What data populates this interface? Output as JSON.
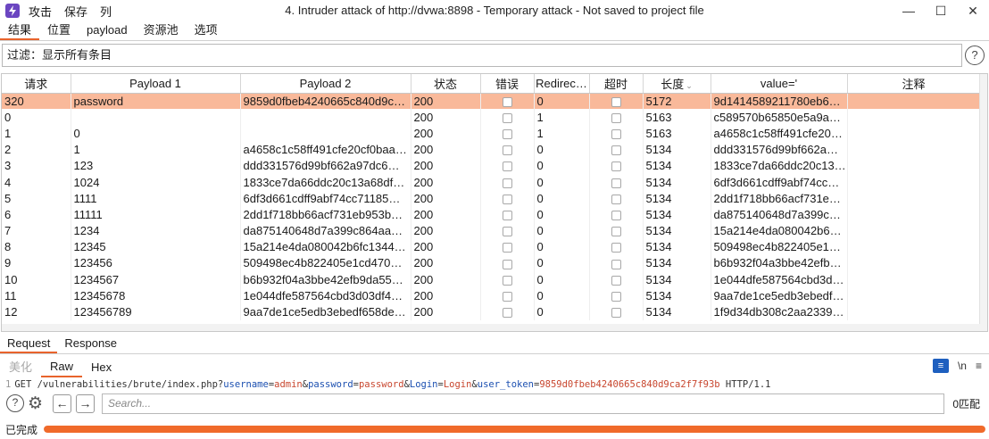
{
  "window": {
    "title": "4. Intruder attack of http://dvwa:8898 - Temporary attack - Not saved to project file",
    "menu": [
      "攻击",
      "保存",
      "列"
    ],
    "controls": [
      "—",
      "☐",
      "✕"
    ]
  },
  "tabs": [
    "结果",
    "位置",
    "payload",
    "资源池",
    "选项"
  ],
  "active_tab": 0,
  "filter": {
    "text": "过滤：显示所有条目"
  },
  "table": {
    "columns": [
      "请求",
      "Payload 1",
      "Payload 2",
      "状态",
      "错误",
      "Redirec…",
      "超时",
      "长度",
      "value='",
      "注释"
    ],
    "rows": [
      [
        "320",
        "password",
        "9859d0fbeb4240665c840d9c…",
        "200",
        "",
        "0",
        "",
        "5172",
        "9d1414589211780eb6…",
        ""
      ],
      [
        "0",
        "",
        "",
        "200",
        "",
        "1",
        "",
        "5163",
        "c589570b65850e5a9a…",
        ""
      ],
      [
        "1",
        "0",
        "",
        "200",
        "",
        "1",
        "",
        "5163",
        "a4658c1c58ff491cfe20…",
        ""
      ],
      [
        "2",
        "1",
        "a4658c1c58ff491cfe20cf0baa…",
        "200",
        "",
        "0",
        "",
        "5134",
        "ddd331576d99bf662a…",
        ""
      ],
      [
        "3",
        "123",
        "ddd331576d99bf662a97dc6…",
        "200",
        "",
        "0",
        "",
        "5134",
        "1833ce7da66ddc20c13…",
        ""
      ],
      [
        "4",
        "1024",
        "1833ce7da66ddc20c13a68df…",
        "200",
        "",
        "0",
        "",
        "5134",
        "6df3d661cdff9abf74cc…",
        ""
      ],
      [
        "5",
        "1111",
        "6df3d661cdff9abf74cc71185…",
        "200",
        "",
        "0",
        "",
        "5134",
        "2dd1f718bb66acf731e…",
        ""
      ],
      [
        "6",
        "11111",
        "2dd1f718bb66acf731eb953b…",
        "200",
        "",
        "0",
        "",
        "5134",
        "da875140648d7a399c…",
        ""
      ],
      [
        "7",
        "1234",
        "da875140648d7a399c864aa…",
        "200",
        "",
        "0",
        "",
        "5134",
        "15a214e4da080042b6…",
        ""
      ],
      [
        "8",
        "12345",
        "15a214e4da080042b6fc1344…",
        "200",
        "",
        "0",
        "",
        "5134",
        "509498ec4b822405e1…",
        ""
      ],
      [
        "9",
        "123456",
        "509498ec4b822405e1cd470…",
        "200",
        "",
        "0",
        "",
        "5134",
        "b6b932f04a3bbe42efb…",
        ""
      ],
      [
        "10",
        "1234567",
        "b6b932f04a3bbe42efb9da55…",
        "200",
        "",
        "0",
        "",
        "5134",
        "1e044dfe587564cbd3d…",
        ""
      ],
      [
        "11",
        "12345678",
        "1e044dfe587564cbd3d03df4…",
        "200",
        "",
        "0",
        "",
        "5134",
        "9aa7de1ce5edb3ebedf…",
        ""
      ],
      [
        "12",
        "123456789",
        "9aa7de1ce5edb3ebedf658de…",
        "200",
        "",
        "0",
        "",
        "5134",
        "1f9d34db308c2aa2339…",
        ""
      ]
    ],
    "selected_row": 0
  },
  "req_resp_tabs": [
    "Request",
    "Response"
  ],
  "view_tabs": [
    "美化",
    "Raw",
    "Hex"
  ],
  "view_icons": {
    "wrap": "≡",
    "newline": "\\n",
    "menu": "≡"
  },
  "raw_request": {
    "line_number": "1",
    "method_path": "GET /vulnerabilities/brute/index.php?",
    "params": [
      {
        "name": "username",
        "value": "admin"
      },
      {
        "name": "password",
        "value": "password"
      },
      {
        "name": "Login",
        "value": "Login"
      },
      {
        "name": "user_token",
        "value": "9859d0fbeb4240665c840d9ca2f7f93b"
      }
    ],
    "protocol": " HTTP/1.1"
  },
  "search": {
    "placeholder": "Search...",
    "matches": "0匹配"
  },
  "status": {
    "text": "已完成",
    "progress": 1.0,
    "progress_color": "#f06a2a"
  },
  "colors": {
    "accent": "#e8632c",
    "selected_row": "#f9b99a",
    "icon": "#6b46c1"
  }
}
